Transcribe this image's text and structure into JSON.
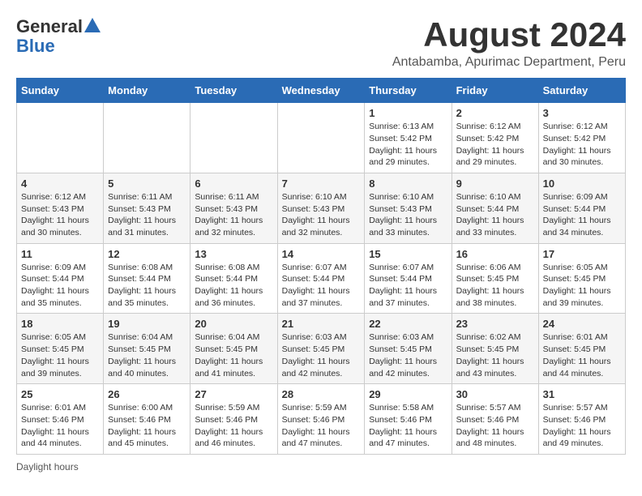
{
  "header": {
    "logo_general": "General",
    "logo_blue": "Blue",
    "month_title": "August 2024",
    "subtitle": "Antabamba, Apurimac Department, Peru"
  },
  "days_of_week": [
    "Sunday",
    "Monday",
    "Tuesday",
    "Wednesday",
    "Thursday",
    "Friday",
    "Saturday"
  ],
  "footer": {
    "daylight_note": "Daylight hours"
  },
  "weeks": [
    [
      {
        "day": "",
        "info": ""
      },
      {
        "day": "",
        "info": ""
      },
      {
        "day": "",
        "info": ""
      },
      {
        "day": "",
        "info": ""
      },
      {
        "day": "1",
        "info": "Sunrise: 6:13 AM\nSunset: 5:42 PM\nDaylight: 11 hours and 29 minutes."
      },
      {
        "day": "2",
        "info": "Sunrise: 6:12 AM\nSunset: 5:42 PM\nDaylight: 11 hours and 29 minutes."
      },
      {
        "day": "3",
        "info": "Sunrise: 6:12 AM\nSunset: 5:42 PM\nDaylight: 11 hours and 30 minutes."
      }
    ],
    [
      {
        "day": "4",
        "info": "Sunrise: 6:12 AM\nSunset: 5:43 PM\nDaylight: 11 hours and 30 minutes."
      },
      {
        "day": "5",
        "info": "Sunrise: 6:11 AM\nSunset: 5:43 PM\nDaylight: 11 hours and 31 minutes."
      },
      {
        "day": "6",
        "info": "Sunrise: 6:11 AM\nSunset: 5:43 PM\nDaylight: 11 hours and 32 minutes."
      },
      {
        "day": "7",
        "info": "Sunrise: 6:10 AM\nSunset: 5:43 PM\nDaylight: 11 hours and 32 minutes."
      },
      {
        "day": "8",
        "info": "Sunrise: 6:10 AM\nSunset: 5:43 PM\nDaylight: 11 hours and 33 minutes."
      },
      {
        "day": "9",
        "info": "Sunrise: 6:10 AM\nSunset: 5:44 PM\nDaylight: 11 hours and 33 minutes."
      },
      {
        "day": "10",
        "info": "Sunrise: 6:09 AM\nSunset: 5:44 PM\nDaylight: 11 hours and 34 minutes."
      }
    ],
    [
      {
        "day": "11",
        "info": "Sunrise: 6:09 AM\nSunset: 5:44 PM\nDaylight: 11 hours and 35 minutes."
      },
      {
        "day": "12",
        "info": "Sunrise: 6:08 AM\nSunset: 5:44 PM\nDaylight: 11 hours and 35 minutes."
      },
      {
        "day": "13",
        "info": "Sunrise: 6:08 AM\nSunset: 5:44 PM\nDaylight: 11 hours and 36 minutes."
      },
      {
        "day": "14",
        "info": "Sunrise: 6:07 AM\nSunset: 5:44 PM\nDaylight: 11 hours and 37 minutes."
      },
      {
        "day": "15",
        "info": "Sunrise: 6:07 AM\nSunset: 5:44 PM\nDaylight: 11 hours and 37 minutes."
      },
      {
        "day": "16",
        "info": "Sunrise: 6:06 AM\nSunset: 5:45 PM\nDaylight: 11 hours and 38 minutes."
      },
      {
        "day": "17",
        "info": "Sunrise: 6:05 AM\nSunset: 5:45 PM\nDaylight: 11 hours and 39 minutes."
      }
    ],
    [
      {
        "day": "18",
        "info": "Sunrise: 6:05 AM\nSunset: 5:45 PM\nDaylight: 11 hours and 39 minutes."
      },
      {
        "day": "19",
        "info": "Sunrise: 6:04 AM\nSunset: 5:45 PM\nDaylight: 11 hours and 40 minutes."
      },
      {
        "day": "20",
        "info": "Sunrise: 6:04 AM\nSunset: 5:45 PM\nDaylight: 11 hours and 41 minutes."
      },
      {
        "day": "21",
        "info": "Sunrise: 6:03 AM\nSunset: 5:45 PM\nDaylight: 11 hours and 42 minutes."
      },
      {
        "day": "22",
        "info": "Sunrise: 6:03 AM\nSunset: 5:45 PM\nDaylight: 11 hours and 42 minutes."
      },
      {
        "day": "23",
        "info": "Sunrise: 6:02 AM\nSunset: 5:45 PM\nDaylight: 11 hours and 43 minutes."
      },
      {
        "day": "24",
        "info": "Sunrise: 6:01 AM\nSunset: 5:45 PM\nDaylight: 11 hours and 44 minutes."
      }
    ],
    [
      {
        "day": "25",
        "info": "Sunrise: 6:01 AM\nSunset: 5:46 PM\nDaylight: 11 hours and 44 minutes."
      },
      {
        "day": "26",
        "info": "Sunrise: 6:00 AM\nSunset: 5:46 PM\nDaylight: 11 hours and 45 minutes."
      },
      {
        "day": "27",
        "info": "Sunrise: 5:59 AM\nSunset: 5:46 PM\nDaylight: 11 hours and 46 minutes."
      },
      {
        "day": "28",
        "info": "Sunrise: 5:59 AM\nSunset: 5:46 PM\nDaylight: 11 hours and 47 minutes."
      },
      {
        "day": "29",
        "info": "Sunrise: 5:58 AM\nSunset: 5:46 PM\nDaylight: 11 hours and 47 minutes."
      },
      {
        "day": "30",
        "info": "Sunrise: 5:57 AM\nSunset: 5:46 PM\nDaylight: 11 hours and 48 minutes."
      },
      {
        "day": "31",
        "info": "Sunrise: 5:57 AM\nSunset: 5:46 PM\nDaylight: 11 hours and 49 minutes."
      }
    ]
  ]
}
